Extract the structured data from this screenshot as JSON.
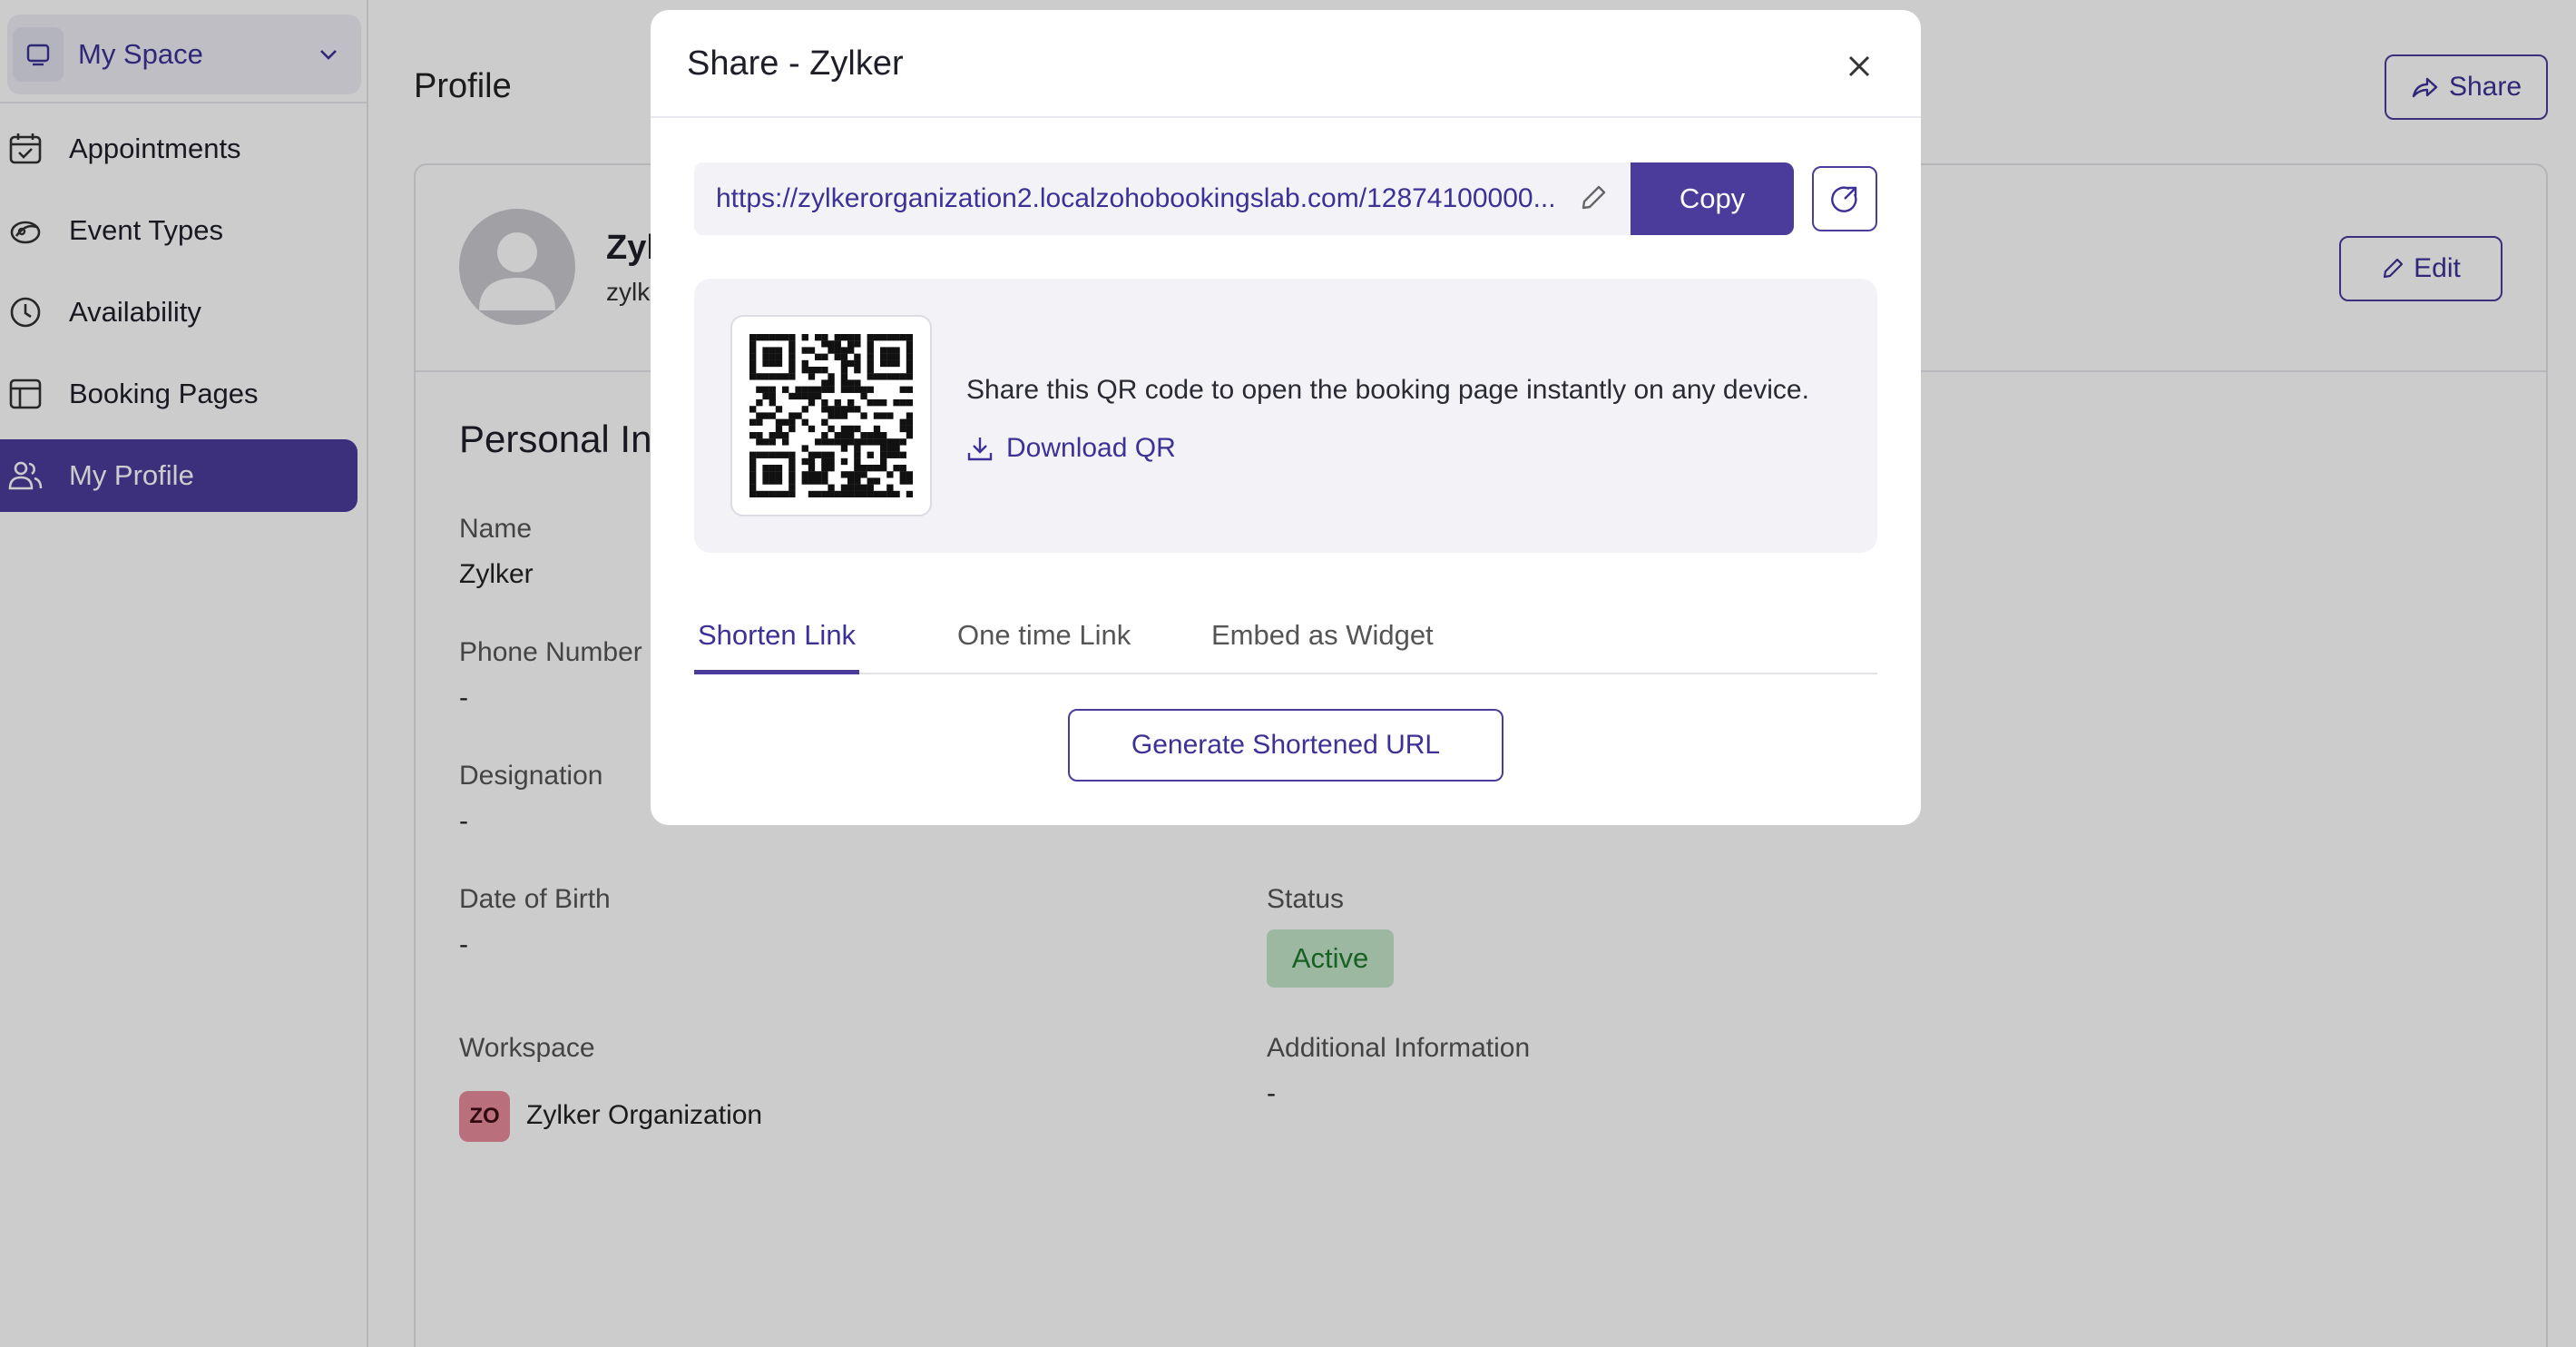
{
  "sidebar": {
    "space_label": "My Space",
    "items": [
      {
        "label": "Appointments"
      },
      {
        "label": "Event Types"
      },
      {
        "label": "Availability"
      },
      {
        "label": "Booking Pages"
      },
      {
        "label": "My Profile",
        "active": true
      }
    ]
  },
  "header": {
    "title": "Profile",
    "share_label": "Share"
  },
  "profile": {
    "name": "Zylker",
    "email": "zylke",
    "edit_label": "Edit",
    "section_title": "Personal Information",
    "fields": {
      "name_label": "Name",
      "name_value": "Zylker",
      "phone_label": "Phone Number",
      "phone_value": "-",
      "designation_label": "Designation",
      "designation_value": "-",
      "right_designation_value": "-",
      "dob_label": "Date of Birth",
      "dob_value": "-",
      "status_label": "Status",
      "status_value": "Active",
      "workspace_label": "Workspace",
      "workspace_badge": "ZO",
      "workspace_value": "Zylker Organization",
      "additional_label": "Additional Information",
      "additional_value": "-"
    }
  },
  "modal": {
    "title": "Share - Zylker",
    "url": "https://zylkerorganization2.localzohobookingslab.com/12874100000...",
    "copy_label": "Copy",
    "qr_text": "Share this QR code to open the booking page instantly on any device.",
    "download_qr_label": "Download QR",
    "tabs": [
      {
        "label": "Shorten Link",
        "active": true
      },
      {
        "label": "One time Link"
      },
      {
        "label": "Embed as Widget"
      }
    ],
    "generate_label": "Generate Shortened URL"
  },
  "colors": {
    "accent": "#4b3b9a",
    "accent_text": "#3b3196",
    "status_bg": "#c4e7c8",
    "status_text": "#1f7a2e",
    "workspace_badge_bg": "#e88c9c"
  }
}
